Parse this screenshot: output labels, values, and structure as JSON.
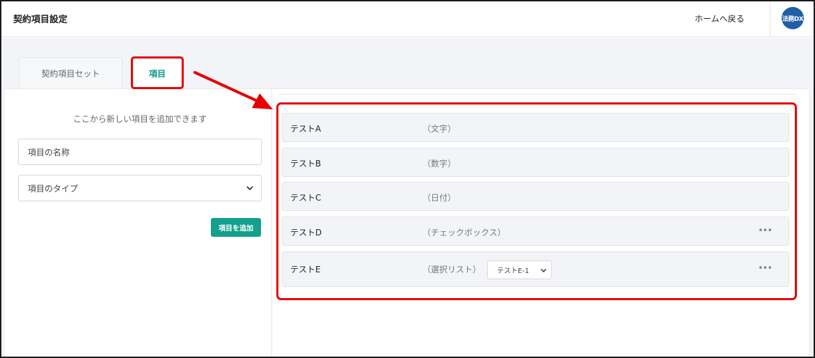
{
  "header": {
    "title": "契約項目設定",
    "home_link": "ホームへ戻る",
    "logo_text": "法務DX"
  },
  "tabs": [
    {
      "label": "契約項目セット",
      "active": false
    },
    {
      "label": "項目",
      "active": true
    }
  ],
  "add_panel": {
    "hint": "ここから新しい項目を追加できます",
    "name_placeholder": "項目の名称",
    "type_placeholder": "項目のタイプ",
    "add_button": "項目を追加"
  },
  "items": [
    {
      "name": "テストA",
      "type": "（文字）"
    },
    {
      "name": "テストB",
      "type": "（数字）"
    },
    {
      "name": "テストC",
      "type": "（日付）"
    },
    {
      "name": "テストD",
      "type": "（チェックボックス）",
      "more": "•••"
    },
    {
      "name": "テストE",
      "type": "（選択リスト）",
      "select_value": "テストE-1",
      "more": "•••"
    }
  ],
  "colors": {
    "accent": "#13a08c",
    "highlight": "#e60000",
    "logo_bg": "#1f5ea8"
  }
}
